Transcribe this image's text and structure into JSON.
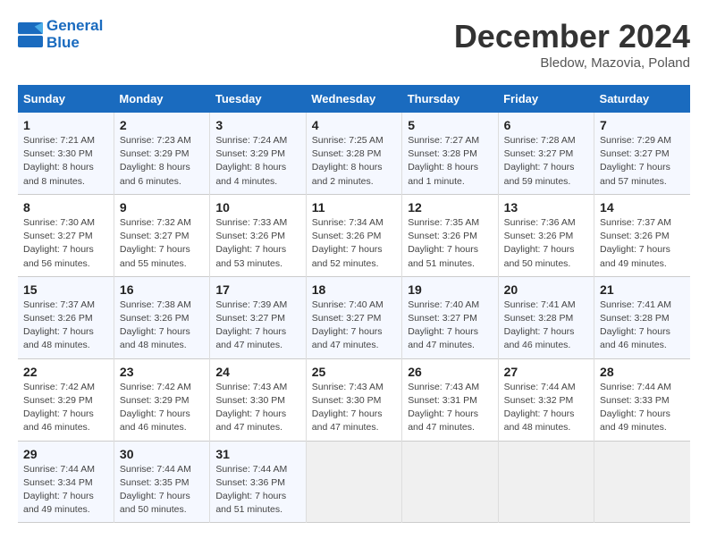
{
  "header": {
    "logo_line1": "General",
    "logo_line2": "Blue",
    "month_title": "December 2024",
    "location": "Bledow, Mazovia, Poland"
  },
  "weekdays": [
    "Sunday",
    "Monday",
    "Tuesday",
    "Wednesday",
    "Thursday",
    "Friday",
    "Saturday"
  ],
  "weeks": [
    [
      {
        "day": "1",
        "sunrise": "Sunrise: 7:21 AM",
        "sunset": "Sunset: 3:30 PM",
        "daylight": "Daylight: 8 hours and 8 minutes."
      },
      {
        "day": "2",
        "sunrise": "Sunrise: 7:23 AM",
        "sunset": "Sunset: 3:29 PM",
        "daylight": "Daylight: 8 hours and 6 minutes."
      },
      {
        "day": "3",
        "sunrise": "Sunrise: 7:24 AM",
        "sunset": "Sunset: 3:29 PM",
        "daylight": "Daylight: 8 hours and 4 minutes."
      },
      {
        "day": "4",
        "sunrise": "Sunrise: 7:25 AM",
        "sunset": "Sunset: 3:28 PM",
        "daylight": "Daylight: 8 hours and 2 minutes."
      },
      {
        "day": "5",
        "sunrise": "Sunrise: 7:27 AM",
        "sunset": "Sunset: 3:28 PM",
        "daylight": "Daylight: 8 hours and 1 minute."
      },
      {
        "day": "6",
        "sunrise": "Sunrise: 7:28 AM",
        "sunset": "Sunset: 3:27 PM",
        "daylight": "Daylight: 7 hours and 59 minutes."
      },
      {
        "day": "7",
        "sunrise": "Sunrise: 7:29 AM",
        "sunset": "Sunset: 3:27 PM",
        "daylight": "Daylight: 7 hours and 57 minutes."
      }
    ],
    [
      {
        "day": "8",
        "sunrise": "Sunrise: 7:30 AM",
        "sunset": "Sunset: 3:27 PM",
        "daylight": "Daylight: 7 hours and 56 minutes."
      },
      {
        "day": "9",
        "sunrise": "Sunrise: 7:32 AM",
        "sunset": "Sunset: 3:27 PM",
        "daylight": "Daylight: 7 hours and 55 minutes."
      },
      {
        "day": "10",
        "sunrise": "Sunrise: 7:33 AM",
        "sunset": "Sunset: 3:26 PM",
        "daylight": "Daylight: 7 hours and 53 minutes."
      },
      {
        "day": "11",
        "sunrise": "Sunrise: 7:34 AM",
        "sunset": "Sunset: 3:26 PM",
        "daylight": "Daylight: 7 hours and 52 minutes."
      },
      {
        "day": "12",
        "sunrise": "Sunrise: 7:35 AM",
        "sunset": "Sunset: 3:26 PM",
        "daylight": "Daylight: 7 hours and 51 minutes."
      },
      {
        "day": "13",
        "sunrise": "Sunrise: 7:36 AM",
        "sunset": "Sunset: 3:26 PM",
        "daylight": "Daylight: 7 hours and 50 minutes."
      },
      {
        "day": "14",
        "sunrise": "Sunrise: 7:37 AM",
        "sunset": "Sunset: 3:26 PM",
        "daylight": "Daylight: 7 hours and 49 minutes."
      }
    ],
    [
      {
        "day": "15",
        "sunrise": "Sunrise: 7:37 AM",
        "sunset": "Sunset: 3:26 PM",
        "daylight": "Daylight: 7 hours and 48 minutes."
      },
      {
        "day": "16",
        "sunrise": "Sunrise: 7:38 AM",
        "sunset": "Sunset: 3:26 PM",
        "daylight": "Daylight: 7 hours and 48 minutes."
      },
      {
        "day": "17",
        "sunrise": "Sunrise: 7:39 AM",
        "sunset": "Sunset: 3:27 PM",
        "daylight": "Daylight: 7 hours and 47 minutes."
      },
      {
        "day": "18",
        "sunrise": "Sunrise: 7:40 AM",
        "sunset": "Sunset: 3:27 PM",
        "daylight": "Daylight: 7 hours and 47 minutes."
      },
      {
        "day": "19",
        "sunrise": "Sunrise: 7:40 AM",
        "sunset": "Sunset: 3:27 PM",
        "daylight": "Daylight: 7 hours and 47 minutes."
      },
      {
        "day": "20",
        "sunrise": "Sunrise: 7:41 AM",
        "sunset": "Sunset: 3:28 PM",
        "daylight": "Daylight: 7 hours and 46 minutes."
      },
      {
        "day": "21",
        "sunrise": "Sunrise: 7:41 AM",
        "sunset": "Sunset: 3:28 PM",
        "daylight": "Daylight: 7 hours and 46 minutes."
      }
    ],
    [
      {
        "day": "22",
        "sunrise": "Sunrise: 7:42 AM",
        "sunset": "Sunset: 3:29 PM",
        "daylight": "Daylight: 7 hours and 46 minutes."
      },
      {
        "day": "23",
        "sunrise": "Sunrise: 7:42 AM",
        "sunset": "Sunset: 3:29 PM",
        "daylight": "Daylight: 7 hours and 46 minutes."
      },
      {
        "day": "24",
        "sunrise": "Sunrise: 7:43 AM",
        "sunset": "Sunset: 3:30 PM",
        "daylight": "Daylight: 7 hours and 47 minutes."
      },
      {
        "day": "25",
        "sunrise": "Sunrise: 7:43 AM",
        "sunset": "Sunset: 3:30 PM",
        "daylight": "Daylight: 7 hours and 47 minutes."
      },
      {
        "day": "26",
        "sunrise": "Sunrise: 7:43 AM",
        "sunset": "Sunset: 3:31 PM",
        "daylight": "Daylight: 7 hours and 47 minutes."
      },
      {
        "day": "27",
        "sunrise": "Sunrise: 7:44 AM",
        "sunset": "Sunset: 3:32 PM",
        "daylight": "Daylight: 7 hours and 48 minutes."
      },
      {
        "day": "28",
        "sunrise": "Sunrise: 7:44 AM",
        "sunset": "Sunset: 3:33 PM",
        "daylight": "Daylight: 7 hours and 49 minutes."
      }
    ],
    [
      {
        "day": "29",
        "sunrise": "Sunrise: 7:44 AM",
        "sunset": "Sunset: 3:34 PM",
        "daylight": "Daylight: 7 hours and 49 minutes."
      },
      {
        "day": "30",
        "sunrise": "Sunrise: 7:44 AM",
        "sunset": "Sunset: 3:35 PM",
        "daylight": "Daylight: 7 hours and 50 minutes."
      },
      {
        "day": "31",
        "sunrise": "Sunrise: 7:44 AM",
        "sunset": "Sunset: 3:36 PM",
        "daylight": "Daylight: 7 hours and 51 minutes."
      },
      null,
      null,
      null,
      null
    ]
  ]
}
